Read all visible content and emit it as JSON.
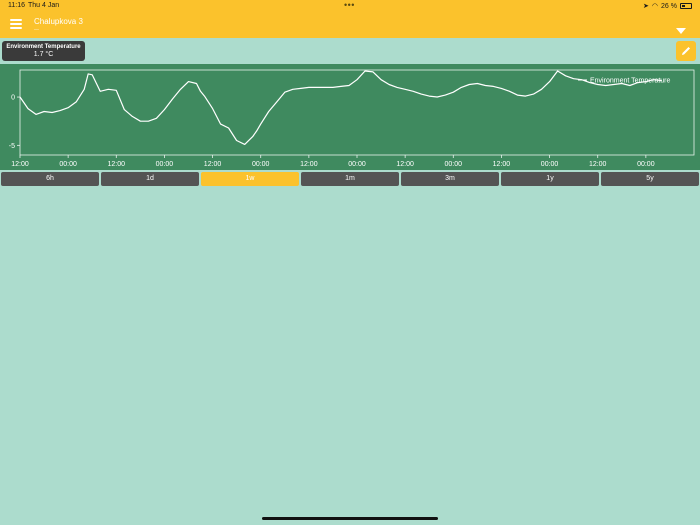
{
  "status_bar": {
    "time": "11:16",
    "date": "Thu 4 Jan",
    "battery": "26 %"
  },
  "header": {
    "title": "Chalupkova 3",
    "subtitle": "—"
  },
  "value_card": {
    "label": "Environment Temperature",
    "value": "1.7 °C"
  },
  "range_tabs": [
    {
      "label": "6h",
      "active": false
    },
    {
      "label": "1d",
      "active": false
    },
    {
      "label": "1w",
      "active": true
    },
    {
      "label": "1m",
      "active": false
    },
    {
      "label": "3m",
      "active": false
    },
    {
      "label": "1y",
      "active": false
    },
    {
      "label": "5y",
      "active": false
    }
  ],
  "colors": {
    "accent": "#fbc22c",
    "chart_bg": "#3f8a5f",
    "page_bg": "#acdccd",
    "tab_bg": "#545454"
  },
  "chart_data": {
    "type": "line",
    "title": "",
    "xlabel": "",
    "ylabel": "",
    "legend": "top-right",
    "grid": false,
    "x_unit": "hours",
    "xlim": [
      0,
      168
    ],
    "ylim": [
      -6,
      2.8
    ],
    "y_ticks": [
      0,
      -5
    ],
    "y_tick_labels": [
      "0",
      "-5"
    ],
    "x_ticks": [
      0,
      12,
      24,
      36,
      48,
      60,
      72,
      84,
      96,
      108,
      120,
      132,
      144,
      156
    ],
    "x_tick_labels": [
      "12:00",
      "00:00",
      "12:00",
      "00:00",
      "12:00",
      "00:00",
      "12:00",
      "00:00",
      "12:00",
      "00:00",
      "12:00",
      "00:00",
      "12:00",
      "00:00"
    ],
    "series": [
      {
        "name": "Environment Temperature",
        "color": "#ffffff",
        "x": [
          0,
          2,
          4,
          6,
          8,
          10,
          12,
          14,
          16,
          17,
          18,
          20,
          22,
          24,
          26,
          28,
          30,
          32,
          34,
          36,
          38,
          40,
          42,
          44,
          45,
          46,
          48,
          50,
          52,
          54,
          56,
          58,
          59,
          60,
          62,
          64,
          66,
          68,
          70,
          72,
          74,
          76,
          78,
          80,
          82,
          84,
          86,
          88,
          90,
          92,
          94,
          96,
          98,
          100,
          102,
          104,
          106,
          108,
          110,
          112,
          114,
          116,
          118,
          120,
          122,
          124,
          126,
          128,
          130,
          132,
          134,
          136,
          138,
          140,
          142,
          144,
          146,
          148,
          150,
          152,
          154,
          156,
          158,
          160
        ],
        "y": [
          0,
          -1.2,
          -1.8,
          -1.5,
          -1.6,
          -1.4,
          -1.1,
          -0.5,
          0.8,
          2.4,
          2.3,
          0.6,
          0.8,
          0.7,
          -1.3,
          -2,
          -2.5,
          -2.5,
          -2.2,
          -1.3,
          -0.2,
          0.8,
          1.6,
          1.4,
          0.6,
          0.1,
          -1.2,
          -2.8,
          -3.2,
          -4.5,
          -4.9,
          -4.1,
          -3.5,
          -2.8,
          -1.5,
          -0.5,
          0.5,
          0.8,
          0.9,
          1,
          1,
          1,
          1,
          1.1,
          1.2,
          1.8,
          2.7,
          2.6,
          1.8,
          1.3,
          1,
          0.8,
          0.6,
          0.3,
          0.1,
          0,
          0.2,
          0.5,
          1,
          1.3,
          1.4,
          1.2,
          1.1,
          0.9,
          0.6,
          0.2,
          0.1,
          0.3,
          0.8,
          1.6,
          2.7,
          2.2,
          1.9,
          1.8,
          1.5,
          1.3,
          1.2,
          1.3,
          1.4,
          1.2,
          1.5,
          1.6,
          1.8,
          1.7
        ]
      }
    ]
  }
}
